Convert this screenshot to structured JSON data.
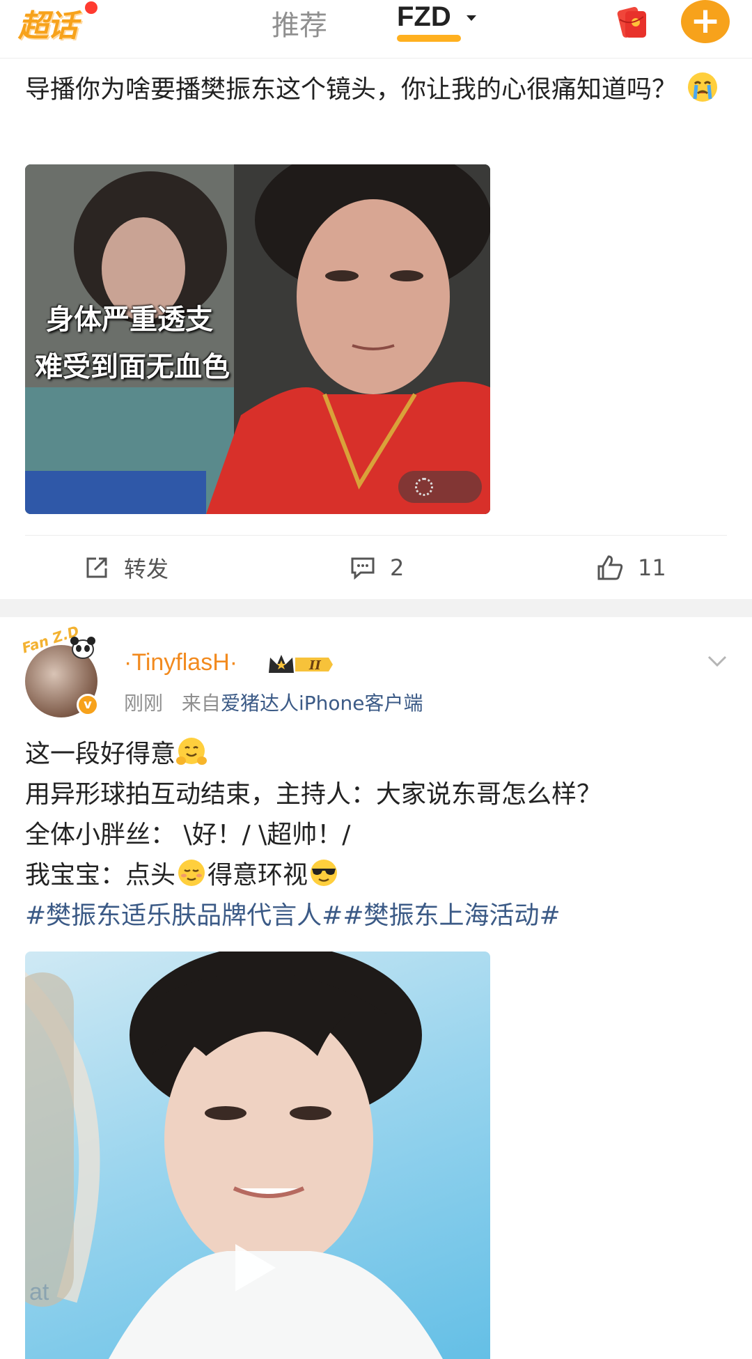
{
  "topbar": {
    "logo_text": "超话",
    "tab_recommend": "推荐",
    "tab_active": "FZD",
    "icons": [
      "red-packet-icon",
      "plus-icon"
    ],
    "accent_color": "#f7a21b"
  },
  "post1": {
    "text": "导播你为啥要播樊振东这个镜头，你让我的心很痛知道吗？",
    "image_caption_line1": "身体严重透支",
    "image_caption_line2": "难受到面无血色",
    "actions": {
      "repost_label": "转发",
      "comment_count": "2",
      "like_count": "11"
    }
  },
  "post2": {
    "username": "·TinyflasH·",
    "avatar_badge": "v",
    "level_badge": "II",
    "avatar_deco_text": "Fan Z.D",
    "time": "刚刚",
    "source_prefix": "来自",
    "source": "爱猪达人iPhone客户端",
    "line1": "这一段好得意",
    "line2": "用异形球拍互动结束，主持人：大家说东哥怎么样？",
    "line3": "全体小胖丝： \\好！/ \\超帅！/",
    "line4_a": "我宝宝：点头",
    "line4_b": "得意环视",
    "hashtags": "#樊振东适乐肤品牌代言人##樊振东上海活动#"
  }
}
